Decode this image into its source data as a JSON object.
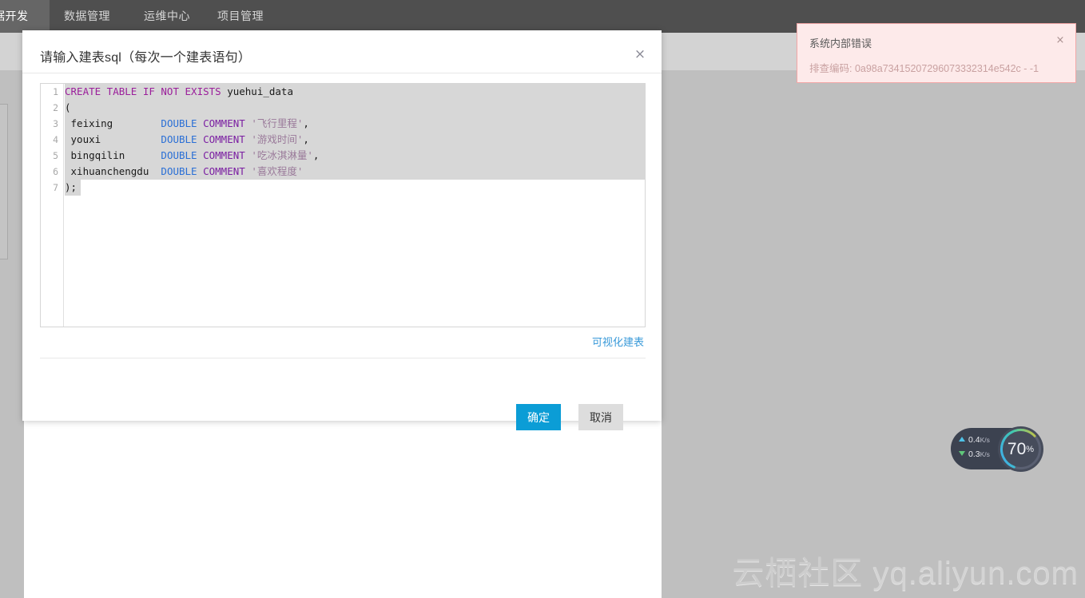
{
  "topnav": {
    "items": [
      {
        "label": "据开发",
        "active": true
      },
      {
        "label": "数据管理",
        "active": false
      },
      {
        "label": "运维中心",
        "active": false
      },
      {
        "label": "项目管理",
        "active": false
      }
    ]
  },
  "modal": {
    "title": "请输入建表sql（每次一个建表语句）",
    "close_icon": "close-icon",
    "close_glyph": "×",
    "editor": {
      "line_numbers": [
        "1",
        "2",
        "3",
        "4",
        "5",
        "6",
        "7"
      ],
      "lines": [
        {
          "tokens": [
            {
              "t": "CREATE TABLE IF NOT EXISTS",
              "c": "kw"
            },
            {
              "t": " yuehui_data",
              "c": "plain"
            }
          ]
        },
        {
          "tokens": [
            {
              "t": "(",
              "c": "plain"
            }
          ]
        },
        {
          "tokens": [
            {
              "t": " feixing        ",
              "c": "plain"
            },
            {
              "t": "DOUBLE",
              "c": "type"
            },
            {
              "t": " ",
              "c": "plain"
            },
            {
              "t": "COMMENT",
              "c": "kw2"
            },
            {
              "t": " ",
              "c": "plain"
            },
            {
              "t": "'飞行里程'",
              "c": "str"
            },
            {
              "t": ",",
              "c": "plain"
            }
          ]
        },
        {
          "tokens": [
            {
              "t": " youxi          ",
              "c": "plain"
            },
            {
              "t": "DOUBLE",
              "c": "type"
            },
            {
              "t": " ",
              "c": "plain"
            },
            {
              "t": "COMMENT",
              "c": "kw2"
            },
            {
              "t": " ",
              "c": "plain"
            },
            {
              "t": "'游戏时间'",
              "c": "str"
            },
            {
              "t": ",",
              "c": "plain"
            }
          ]
        },
        {
          "tokens": [
            {
              "t": " bingqilin      ",
              "c": "plain"
            },
            {
              "t": "DOUBLE",
              "c": "type"
            },
            {
              "t": " ",
              "c": "plain"
            },
            {
              "t": "COMMENT",
              "c": "kw2"
            },
            {
              "t": " ",
              "c": "plain"
            },
            {
              "t": "'吃冰淇淋量'",
              "c": "str"
            },
            {
              "t": ",",
              "c": "plain"
            }
          ]
        },
        {
          "tokens": [
            {
              "t": " xihuanchengdu  ",
              "c": "plain"
            },
            {
              "t": "DOUBLE",
              "c": "type"
            },
            {
              "t": " ",
              "c": "plain"
            },
            {
              "t": "COMMENT",
              "c": "kw2"
            },
            {
              "t": " ",
              "c": "plain"
            },
            {
              "t": "'喜欢程度'",
              "c": "str"
            }
          ]
        },
        {
          "tokens": [
            {
              "t": ");",
              "c": "plain"
            }
          ]
        }
      ]
    },
    "visual_link": "可视化建表",
    "confirm_label": "确定",
    "cancel_label": "取消"
  },
  "toast": {
    "title": "系统内部错误",
    "body": "排查编码: 0a98a73415207296073332314e542c - -1",
    "close_glyph": "×",
    "border_color": "#f2a6a6",
    "background_color": "#fdeaea"
  },
  "net_widget": {
    "upload": "0.4",
    "upload_unit": "K/s",
    "download": "0.3",
    "download_unit": "K/s",
    "gauge_value": "70",
    "gauge_unit": "%",
    "gauge_percent": 70
  },
  "watermark": {
    "cn": "云栖社区",
    "en": " yq.aliyun.com"
  },
  "colors": {
    "primary_button": "#0b9dd6",
    "link": "#3a9ad9",
    "keyword": "#9b1f9b",
    "type": "#2a6fd6",
    "string": "#9a7a9a",
    "topnav": "#4f4f4f"
  }
}
